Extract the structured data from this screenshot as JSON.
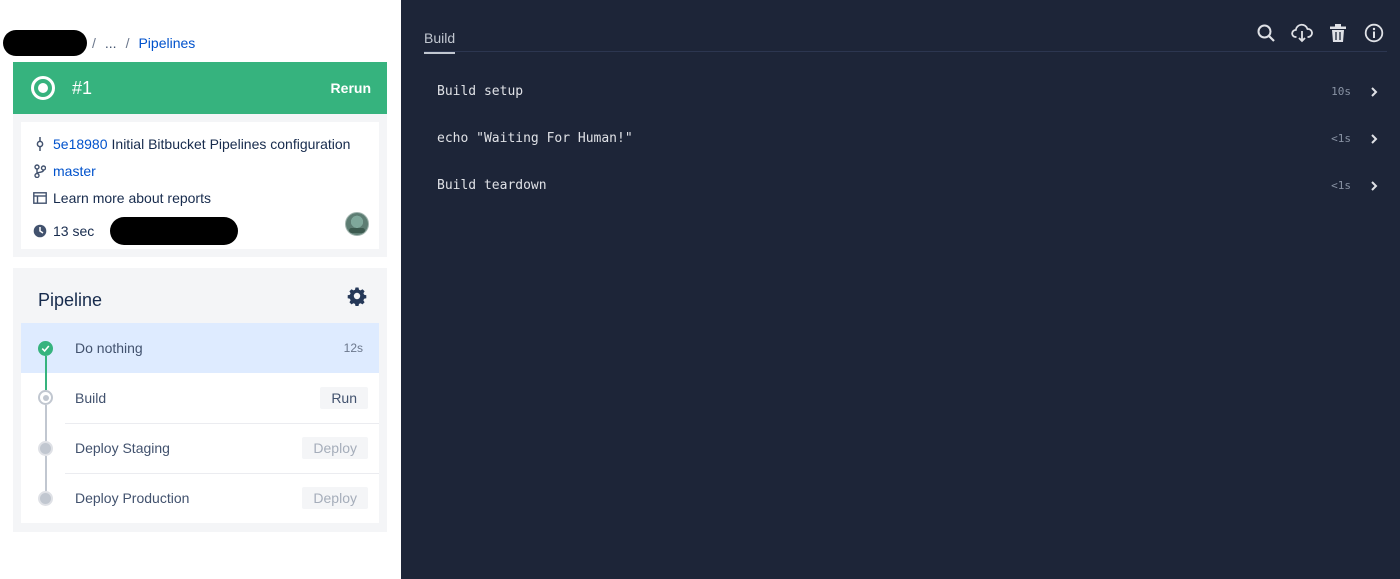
{
  "breadcrumb": {
    "ellipsis": "...",
    "current": "Pipelines"
  },
  "status": {
    "run_number": "#1",
    "rerun_label": "Rerun",
    "color": "#36b37e"
  },
  "info": {
    "commit_hash": "5e18980",
    "commit_message": "Initial Bitbucket Pipelines configuration",
    "branch": "master",
    "reports_link": "Learn more about reports",
    "duration": "13 sec"
  },
  "pipeline": {
    "title": "Pipeline",
    "steps": [
      {
        "name": "Do nothing",
        "time": "12s",
        "status": "success"
      },
      {
        "name": "Build",
        "action": "Run",
        "status": "pending"
      },
      {
        "name": "Deploy Staging",
        "action": "Deploy",
        "status": "disabled"
      },
      {
        "name": "Deploy Production",
        "action": "Deploy",
        "status": "disabled"
      }
    ]
  },
  "log": {
    "tab": "Build",
    "toolbar": [
      "search-icon",
      "download-icon",
      "trash-icon",
      "info-icon"
    ],
    "rows": [
      {
        "label": "Build setup",
        "time": "10s"
      },
      {
        "label": "echo \"Waiting For Human!\"",
        "time": "<1s"
      },
      {
        "label": "Build teardown",
        "time": "<1s"
      }
    ]
  }
}
